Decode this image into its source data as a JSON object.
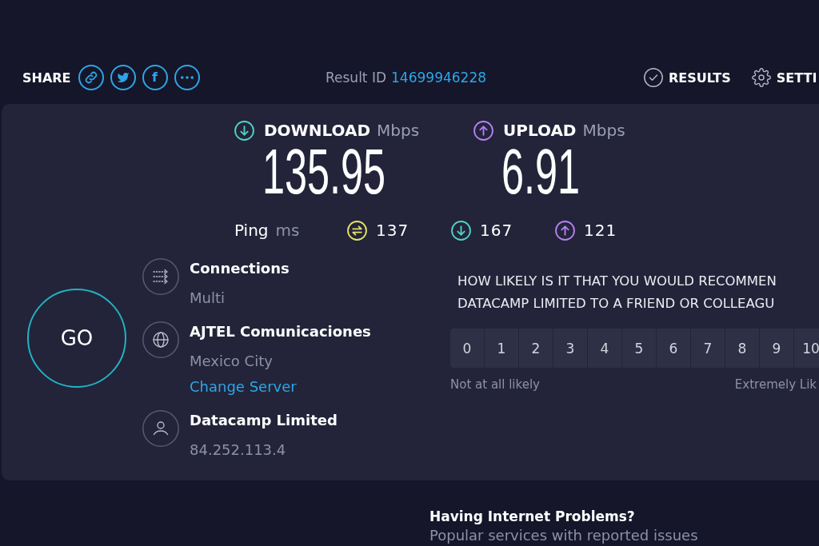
{
  "share": {
    "label": "SHARE",
    "buttons": [
      {
        "kind": "link"
      },
      {
        "kind": "bird"
      },
      {
        "kind": "letter",
        "label": "f"
      },
      {
        "kind": "more"
      }
    ]
  },
  "result": {
    "label": "Result ID",
    "id": "14699946228"
  },
  "nav": [
    {
      "kind": "results",
      "label": "RESULTS"
    },
    {
      "kind": "settings",
      "label": "SETTI"
    }
  ],
  "speeds": [
    {
      "kind": "download",
      "label": "DOWNLOAD",
      "unit": "Mbps",
      "value": "135.95"
    },
    {
      "kind": "upload",
      "label": "UPLOAD",
      "unit": "Mbps",
      "value": "6.91"
    }
  ],
  "ping": {
    "label": "Ping",
    "unit": "ms",
    "stats": [
      {
        "kind": "idle",
        "value": "137"
      },
      {
        "kind": "download",
        "value": "167"
      },
      {
        "kind": "upload",
        "value": "121"
      }
    ]
  },
  "go_button": {
    "label": "GO"
  },
  "details": [
    {
      "kind": "connections",
      "title": "Connections",
      "value": "Multi"
    },
    {
      "kind": "server",
      "title": "AJTEL Comunicaciones",
      "value": "Mexico City",
      "link": "Change Server"
    },
    {
      "kind": "provider",
      "title": "Datacamp Limited",
      "value": "84.252.113.4"
    }
  ],
  "survey": {
    "question_lines": [
      "HOW LIKELY IS IT THAT YOU WOULD RECOMMEN",
      "DATACAMP LIMITED TO A FRIEND OR COLLEAGU"
    ],
    "scale": [
      "0",
      "1",
      "2",
      "3",
      "4",
      "5",
      "6",
      "7",
      "8",
      "9",
      "10"
    ],
    "low_label": "Not at all likely",
    "high_label": "Extremely Lik"
  },
  "problems": {
    "title": "Having Internet Problems?",
    "subtitle": "Popular services with reported issues"
  }
}
